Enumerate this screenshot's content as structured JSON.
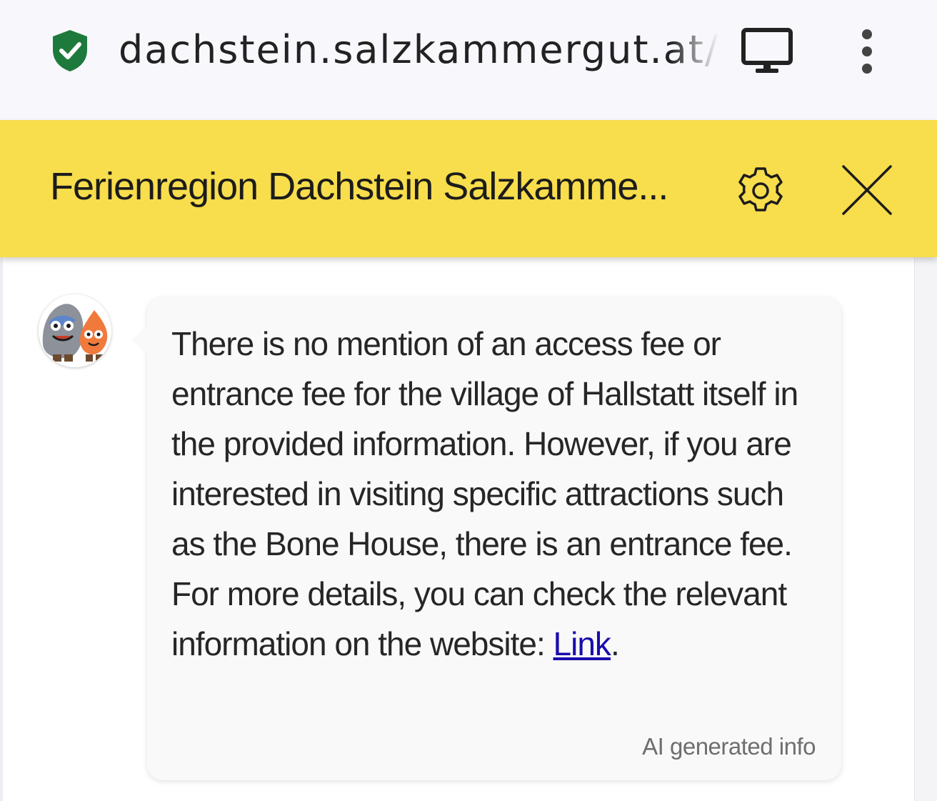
{
  "browser": {
    "url": "dachstein.salzkammergut.at/e",
    "icons": {
      "secure": "shield-check-icon",
      "desktop": "desktop-site-icon",
      "menu": "vertical-dots-menu-icon"
    },
    "colors": {
      "shield": "#1e7a3c"
    }
  },
  "header": {
    "title": "Ferienregion Dachstein Salzkamme...",
    "settings_icon": "gear-icon",
    "close_icon": "close-icon",
    "background": "#f8dd4c"
  },
  "chat": {
    "avatar_icon": "mascot-avatar-icon",
    "message": "There is no mention of an access fee or entrance fee for the village of Hallstatt itself in the provided information. However, if you are interested in visiting specific attractions such as the Bone House, there is an entrance fee. For more details, you can check the relevant information on the website:",
    "link_text": "Link",
    "message_end": ".",
    "footer_note": "AI generated info"
  }
}
